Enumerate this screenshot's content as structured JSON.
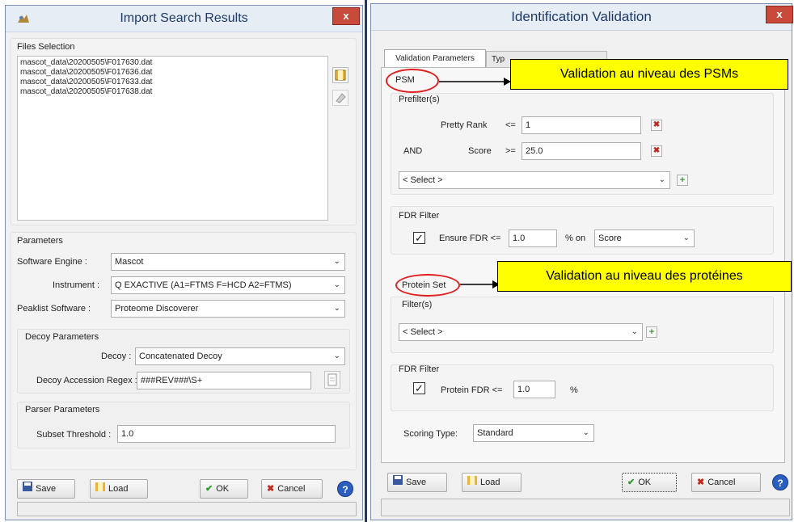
{
  "left_dialog": {
    "title": "Import Search Results",
    "close_label": "x",
    "files_selection": {
      "group_label": "Files Selection",
      "files": [
        "mascot_data\\20200505\\F017630.dat",
        "mascot_data\\20200505\\F017636.dat",
        "mascot_data\\20200505\\F017633.dat",
        "mascot_data\\20200505\\F017638.dat"
      ]
    },
    "parameters": {
      "group_label": "Parameters",
      "software_engine_label": "Software Engine :",
      "software_engine_value": "Mascot",
      "instrument_label": "Instrument :",
      "instrument_value": "Q EXACTIVE (A1=FTMS F=HCD A2=FTMS)",
      "peaklist_label": "Peaklist Software :",
      "peaklist_value": "Proteome Discoverer"
    },
    "decoy": {
      "group_label": "Decoy Parameters",
      "decoy_label": "Decoy :",
      "decoy_value": "Concatenated Decoy",
      "regex_label": "Decoy Accession Regex :",
      "regex_value": "###REV###\\S+"
    },
    "parser": {
      "group_label": "Parser Parameters",
      "subset_label": "Subset Threshold :",
      "subset_value": "1.0"
    },
    "buttons": {
      "save": "Save",
      "load": "Load",
      "ok": "OK",
      "cancel": "Cancel",
      "help": "?"
    }
  },
  "right_dialog": {
    "title": "Identification Validation",
    "close_label": "x",
    "tabs": [
      "Validation Parameters",
      "Typ"
    ],
    "psm": {
      "label": "PSM",
      "callout": "Validation au niveau des PSMs",
      "prefilter_label": "Prefilter(s)",
      "pretty_rank_label": "Pretty Rank",
      "pretty_rank_op": "<=",
      "pretty_rank_value": "1",
      "and_label": "AND",
      "score_label": "Score",
      "score_op": ">=",
      "score_value": "25.0",
      "select_placeholder": "< Select >",
      "fdr_group_label": "FDR Filter",
      "ensure_fdr_label": "Ensure FDR <=",
      "ensure_fdr_value": "1.0",
      "on_label": "% on",
      "on_value": "Score"
    },
    "protein_set": {
      "label": "Protein Set",
      "callout": "Validation au niveau des protéines",
      "filter_label": "Filter(s)",
      "select_placeholder": "< Select >",
      "fdr_group_label": "FDR Filter",
      "protein_fdr_label": "Protein FDR <=",
      "protein_fdr_value": "1.0",
      "percent_label": "%"
    },
    "scoring": {
      "label": "Scoring Type:",
      "value": "Standard"
    },
    "buttons": {
      "save": "Save",
      "load": "Load",
      "ok": "OK",
      "cancel": "Cancel",
      "help": "?"
    }
  },
  "colors": {
    "callout_fill": "#ffff00",
    "ellipse_stroke": "#e02020",
    "close_button": "#c74a3a",
    "separator": "#1f3a68"
  }
}
